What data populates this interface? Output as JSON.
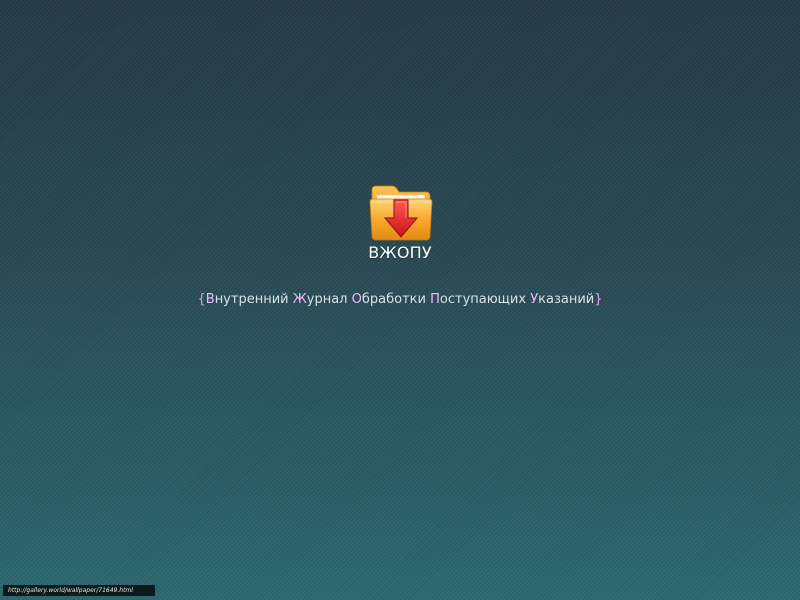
{
  "desktop": {
    "folder": {
      "label": "ВЖОПУ",
      "icon": "folder-download-icon"
    },
    "acronym": {
      "open_brace": "{",
      "close_brace": "}",
      "words": [
        {
          "first": "В",
          "rest": "нутренний"
        },
        {
          "first": "Ж",
          "rest": "урнал"
        },
        {
          "first": "О",
          "rest": "бработки"
        },
        {
          "first": "П",
          "rest": "оступающих"
        },
        {
          "first": "У",
          "rest": "казаний"
        }
      ]
    }
  },
  "watermark": {
    "text": "http://gallery.world/wallpaper/71649.html"
  },
  "colors": {
    "background_top": "#263a47",
    "background_bottom": "#2c6a71",
    "folder_orange": "#f6a623",
    "arrow_red": "#e0242a",
    "acronym_accent": "#f3b6ff"
  }
}
